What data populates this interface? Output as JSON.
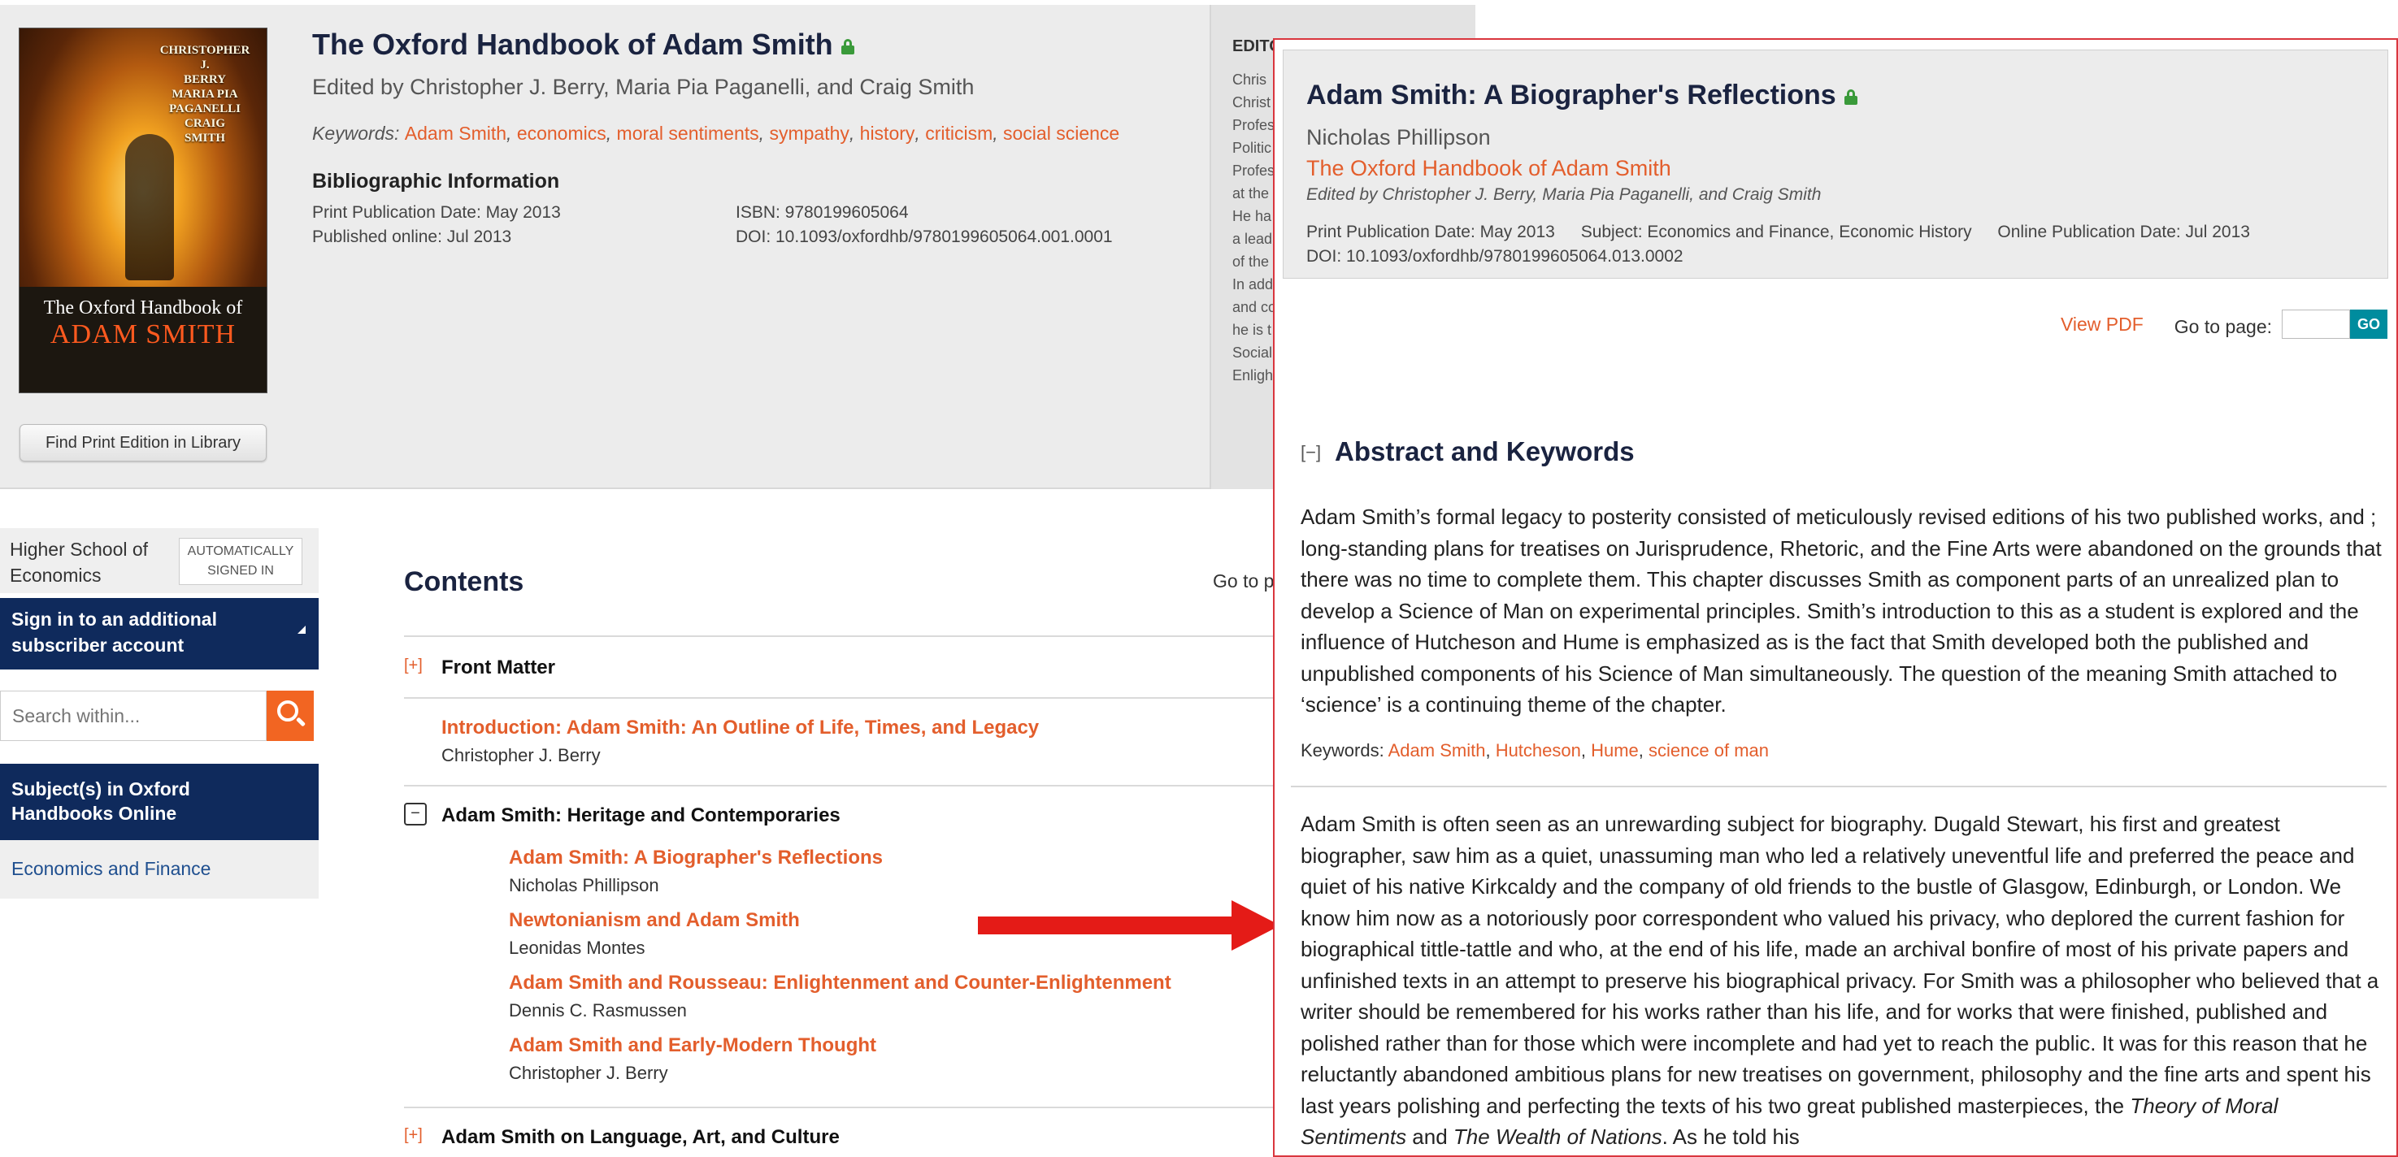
{
  "book": {
    "title": "The Oxford Handbook of Adam Smith",
    "editors": "Edited by Christopher J. Berry, Maria Pia Paganelli, and Craig Smith",
    "keywords_label": "Keywords:",
    "keywords": [
      "Adam Smith",
      "economics",
      "moral sentiments",
      "sympathy",
      "history",
      "criticism",
      "social science"
    ],
    "biblio_heading": "Bibliographic Information",
    "print_pub": "Print Publication Date:  May 2013",
    "published_online": "Published online:  Jul 2013",
    "isbn": "ISBN:  9780199605064",
    "doi": "DOI:  10.1093/oxfordhb/9780199605064.001.0001",
    "find_print_button": "Find Print Edition in Library",
    "cover": {
      "names": [
        "CHRISTOPHER J.",
        "BERRY",
        "MARIA PIA",
        "PAGANELLI",
        "CRAIG",
        "SMITH"
      ],
      "title_small": "The Oxford Handbook of",
      "title_big": "ADAM SMITH"
    }
  },
  "editors_panel": {
    "heading": "EDITO",
    "lines": [
      "Chris",
      "Christ",
      "Profes",
      "Politic",
      "Profes",
      "at the",
      "He ha",
      "a lead",
      "of the",
      "In add",
      "and co",
      "he is t",
      "Social",
      "Enligh"
    ]
  },
  "sidebar": {
    "institution": "Higher School of Economics",
    "auto_badge": "AUTOMATICALLY SIGNED IN",
    "signin_text": "Sign in to an additional subscriber account",
    "search_placeholder": "Search within...",
    "subjects_title": "Subject(s) in Oxford Handbooks Online",
    "subject_link": "Economics and Finance"
  },
  "contents": {
    "title": "Contents",
    "goto_partial": "Go to p",
    "front_matter_toggle": "[+]",
    "front_matter": "Front Matter",
    "intro_title": "Introduction: Adam Smith: An Outline of Life, Times, and Legacy",
    "intro_author": "Christopher J. Berry",
    "part1_toggle": "−",
    "part1_title": "Adam Smith: Heritage and Contemporaries",
    "part1_chapters": [
      {
        "title": "Adam Smith: A Biographer's Reflections",
        "author": "Nicholas Phillipson"
      },
      {
        "title": "Newtonianism and Adam Smith",
        "author": "Leonidas Montes"
      },
      {
        "title": "Adam Smith and Rousseau: Enlightenment and Counter-Enlightenment",
        "author": "Dennis C. Rasmussen"
      },
      {
        "title": "Adam Smith and Early-Modern Thought",
        "author": "Christopher J. Berry"
      }
    ],
    "part2_toggle": "[+]",
    "part2_title": "Adam Smith on Language, Art, and Culture"
  },
  "chapter": {
    "title": "Adam Smith: A Biographer's Reflections",
    "author": "Nicholas Phillipson",
    "book_link": "The Oxford Handbook of Adam Smith",
    "editors": "Edited by Christopher J. Berry, Maria Pia Paganelli, and Craig Smith",
    "print_pub": "Print Publication Date:  May 2013",
    "subject": "Subject:  Economics and Finance, Economic History",
    "online_pub": "Online Publication Date:  Jul 2013",
    "doi": "DOI:  10.1093/oxfordhb/9780199605064.013.0002",
    "view_pdf": "View PDF",
    "goto_label": "Go to page:",
    "go_button": "GO",
    "abstract_toggle": "[−]",
    "abstract_heading": "Abstract and Keywords",
    "abstract": "Adam Smith’s formal legacy to posterity consisted of meticulously revised editions of his two published works, and ; long-standing plans for treatises on Jurisprudence, Rhetoric, and the Fine Arts were abandoned on the grounds that there was no time to complete them. This chapter discusses Smith as component parts of an unrealized plan to develop a Science of Man on experimental principles. Smith’s introduction to this as a student is explored and the influence of Hutcheson and Hume is emphasized as is the fact that Smith developed both the published and unpublished components of his Science of Man simultaneously. The question of the meaning Smith attached to ‘science’ is a continuing theme of the chapter.",
    "keywords_label": "Keywords:",
    "keywords": [
      "Adam Smith",
      "Hutcheson",
      "Hume",
      "science of man"
    ],
    "body_main": "Adam Smith is often seen as an unrewarding subject for biography. Dugald Stewart, his first and greatest biographer, saw him as a quiet, unassuming man who led a relatively uneventful life and preferred the peace and quiet of his native Kirkcaldy and the company of old friends to the bustle of Glasgow, Edinburgh, or London. We know him now as a notoriously poor correspondent who valued his privacy, who deplored the current fashion for biographical tittle-tattle and who, at the end of his life, made an archival bonfire of most of his private papers and unfinished texts in an attempt to preserve his biographical privacy. For Smith was a philosopher who believed that a writer should be remembered for his works rather than his life, and for works that were finished, published and polished rather than for those which were incomplete and had yet to reach the public. It was for this reason that he reluctantly abandoned ambitious plans for new treatises on government, philosophy and the fine arts and spent his last years polishing and perfecting the texts of his two great published masterpieces, the ",
    "body_work1": "Theory of Moral Sentiments",
    "body_and": " and ",
    "body_work2": "The Wealth of Nations",
    "body_end": ". As he told his"
  },
  "colors": {
    "navy": "#0f2a5c",
    "orange_link": "#e35e2c",
    "search_orange": "#f26522",
    "go_teal": "#008c9e",
    "popup_border": "#d9363e",
    "arrow_red": "#e41b17"
  }
}
